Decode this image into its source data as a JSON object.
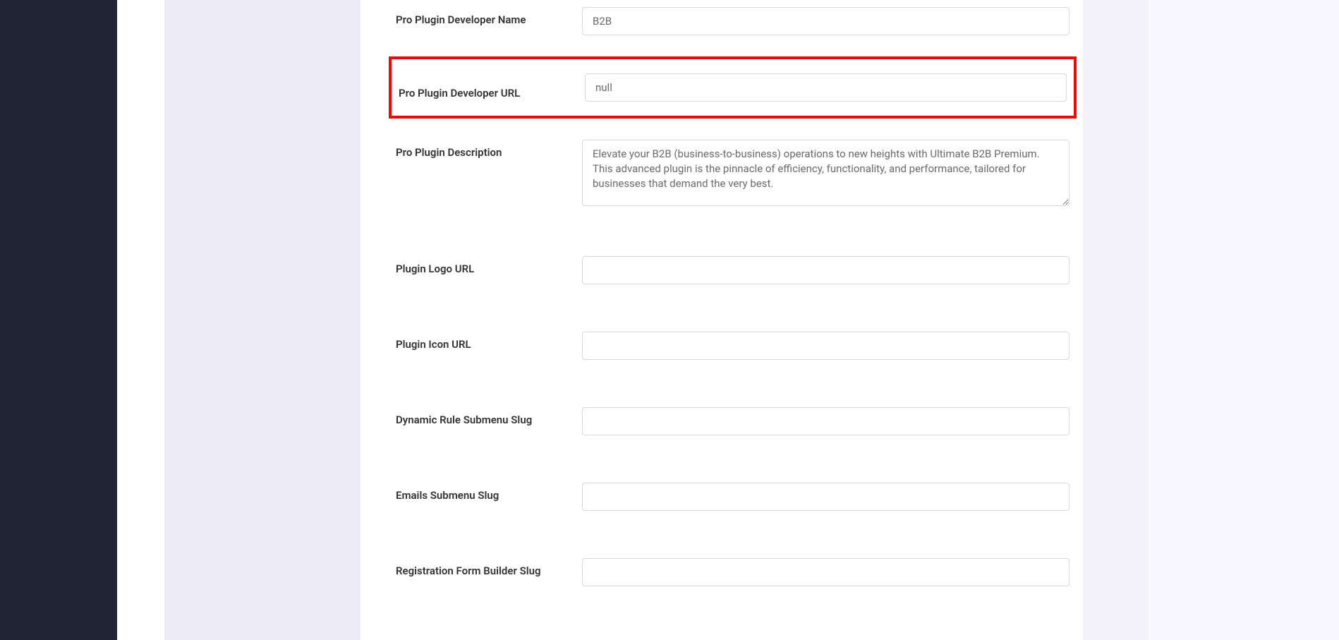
{
  "form": {
    "fields": {
      "developer_name": {
        "label": "Pro Plugin Developer Name",
        "value": "B2B"
      },
      "developer_url": {
        "label": "Pro Plugin Developer URL",
        "value": "null"
      },
      "description": {
        "label": "Pro Plugin Description",
        "value": "Elevate your B2B (business-to-business) operations to new heights with Ultimate B2B Premium. This advanced plugin is the pinnacle of efficiency, functionality, and performance, tailored for businesses that demand the very best."
      },
      "logo_url": {
        "label": "Plugin Logo URL",
        "value": ""
      },
      "icon_url": {
        "label": "Plugin Icon URL",
        "value": ""
      },
      "dynamic_rule_slug": {
        "label": "Dynamic Rule Submenu Slug",
        "value": ""
      },
      "emails_slug": {
        "label": "Emails Submenu Slug",
        "value": ""
      },
      "registration_slug": {
        "label": "Registration Form Builder Slug",
        "value": ""
      }
    }
  }
}
